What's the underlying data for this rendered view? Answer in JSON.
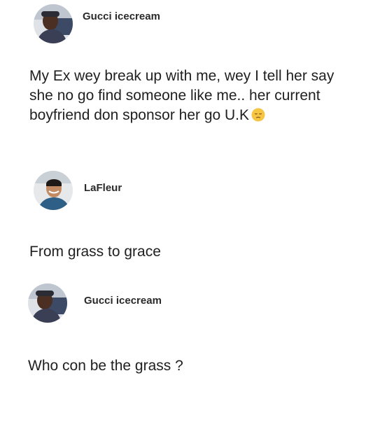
{
  "posts": [
    {
      "author": "Gucci icecream",
      "avatar_icon": "profile-photo-icon",
      "text": "My Ex wey break up with me, wey I tell her say she no go find someone like me.. her current boyfriend don sponsor her go U.K",
      "emoji": "pensive-face-icon"
    },
    {
      "author": "LaFleur",
      "avatar_icon": "profile-photo-icon",
      "text": "From grass to grace"
    },
    {
      "author": "Gucci icecream",
      "avatar_icon": "profile-photo-icon",
      "text": "Who con be the grass ?"
    }
  ]
}
